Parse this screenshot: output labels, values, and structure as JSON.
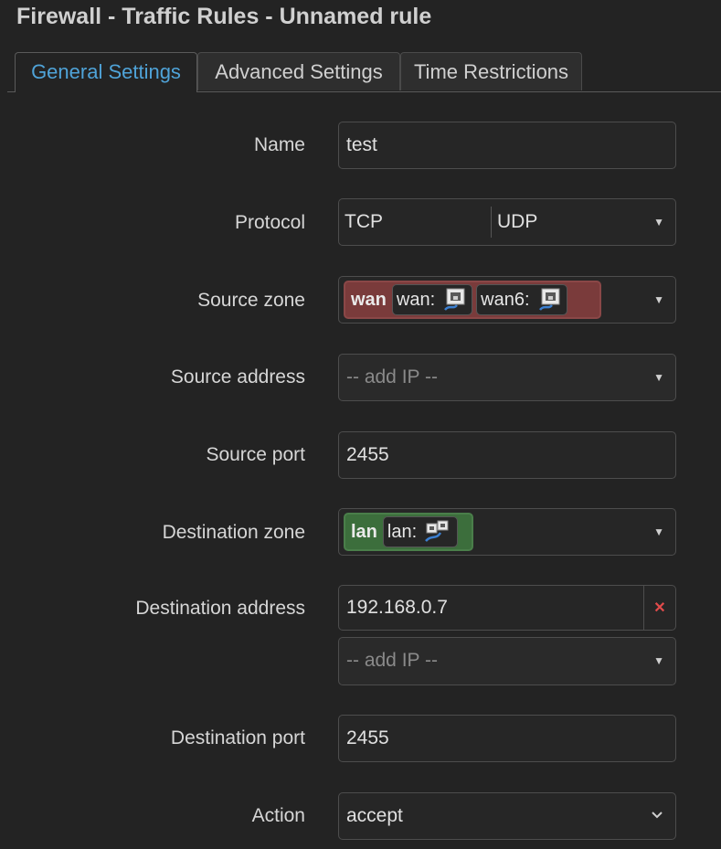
{
  "page": {
    "title": "Firewall - Traffic Rules - Unnamed rule"
  },
  "tabs": [
    {
      "label": "General Settings",
      "active": true
    },
    {
      "label": "Advanced Settings",
      "active": false
    },
    {
      "label": "Time Restrictions",
      "active": false
    }
  ],
  "form": {
    "name": {
      "label": "Name",
      "value": "test"
    },
    "protocol": {
      "label": "Protocol",
      "values": [
        "TCP",
        "UDP"
      ]
    },
    "source_zone": {
      "label": "Source zone",
      "zone": "wan",
      "zone_color": "#7a3b3b",
      "networks": [
        {
          "label": "wan:",
          "icon": "ethernet-port-icon"
        },
        {
          "label": "wan6:",
          "icon": "ethernet-port-icon"
        }
      ]
    },
    "source_address": {
      "label": "Source address",
      "placeholder": "-- add IP --"
    },
    "source_port": {
      "label": "Source port",
      "value": "2455"
    },
    "destination_zone": {
      "label": "Destination zone",
      "zone": "lan",
      "zone_color": "#3c6e3c",
      "networks": [
        {
          "label": "lan:",
          "icon": "bridge-icon"
        }
      ]
    },
    "destination_address": {
      "label": "Destination address",
      "value": "192.168.0.7",
      "placeholder": "-- add IP --"
    },
    "destination_port": {
      "label": "Destination port",
      "value": "2455"
    },
    "action": {
      "label": "Action",
      "value": "accept"
    }
  },
  "colors": {
    "accent": "#4fa3d8",
    "background": "#232323",
    "remove": "#e24b4b"
  }
}
